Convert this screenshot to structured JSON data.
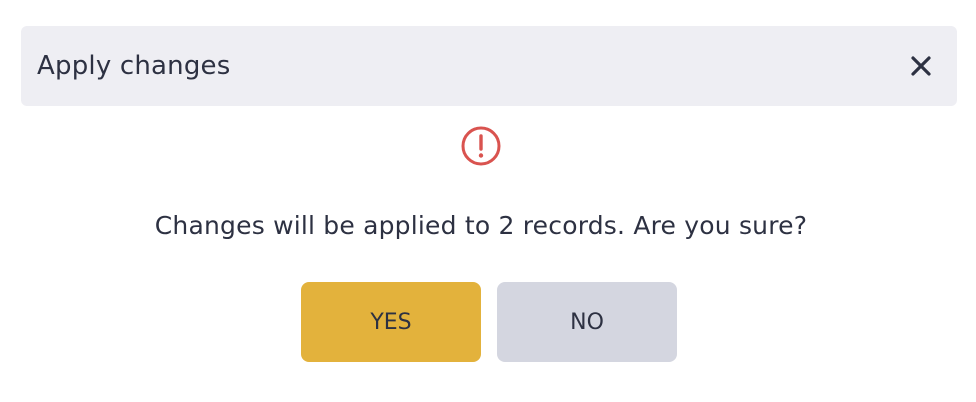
{
  "dialog": {
    "title": "Apply changes",
    "close_icon": "close-icon",
    "alert_icon": "exclamation-circle-icon",
    "message": "Changes will be applied to 2 records. Are you sure?",
    "yes_label": "YES",
    "no_label": "NO"
  },
  "colors": {
    "header_bg": "#eeeef3",
    "alert": "#d9534f",
    "yes_bg": "#e3b23c",
    "no_bg": "#d4d6e0",
    "text": "#2d3142"
  }
}
